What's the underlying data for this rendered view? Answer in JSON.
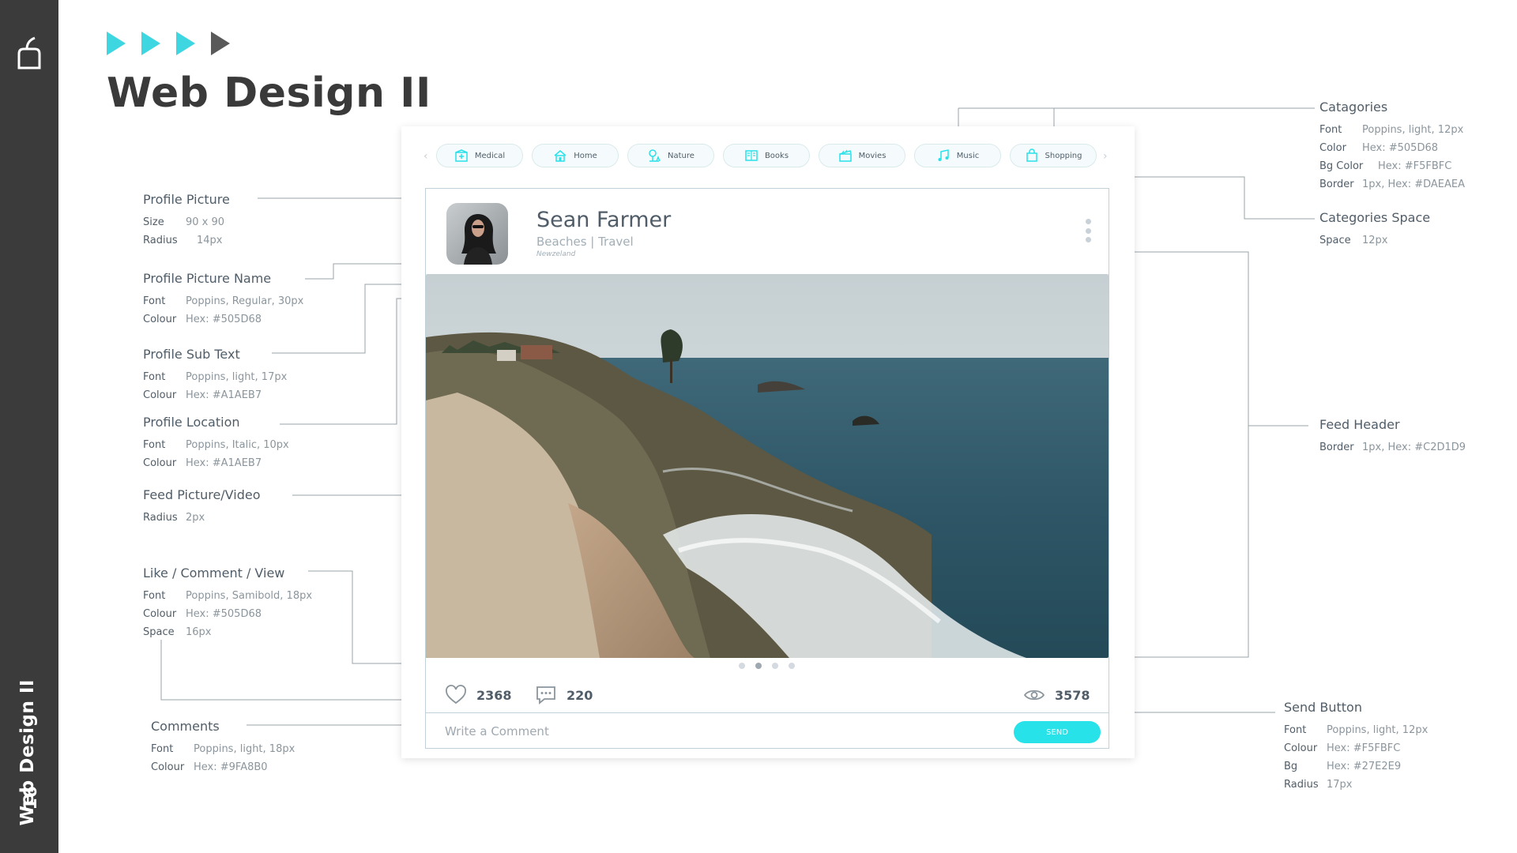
{
  "slide": {
    "title": "Web Design II",
    "rail_label": "Web Design II",
    "page_number": "16",
    "arrow_colors": [
      "#3ED6E0",
      "#3ED6E0",
      "#3ED6E0",
      "#5a5a5a"
    ]
  },
  "annotations": {
    "profile_picture": {
      "title": "Profile Picture",
      "rows": [
        [
          "Size",
          "90 x 90"
        ],
        [
          "Radius",
          "14px"
        ]
      ]
    },
    "profile_name": {
      "title": "Profile Picture Name",
      "rows": [
        [
          "Font",
          "Poppins, Regular, 30px"
        ],
        [
          "Colour",
          "Hex: #505D68"
        ]
      ]
    },
    "profile_sub": {
      "title": "Profile Sub Text",
      "rows": [
        [
          "Font",
          "Poppins, light, 17px"
        ],
        [
          "Colour",
          "Hex: #A1AEB7"
        ]
      ]
    },
    "profile_location": {
      "title": "Profile Location",
      "rows": [
        [
          "Font",
          "Poppins, Italic, 10px"
        ],
        [
          "Colour",
          "Hex: #A1AEB7"
        ]
      ]
    },
    "feed_picture": {
      "title": "Feed Picture/Video",
      "rows": [
        [
          "Radius",
          "2px"
        ]
      ]
    },
    "like_comment_view": {
      "title": "Like / Comment / View",
      "rows": [
        [
          "Font",
          "Poppins, Samibold, 18px"
        ],
        [
          "Colour",
          "Hex: #505D68"
        ],
        [
          "Space",
          "16px"
        ]
      ]
    },
    "comments": {
      "title": "Comments",
      "rows": [
        [
          "Font",
          "Poppins, light, 18px"
        ],
        [
          "Colour",
          "Hex: #9FA8B0"
        ]
      ]
    },
    "categories": {
      "title": "Catagories",
      "rows": [
        [
          "Font",
          "Poppins, light, 12px"
        ],
        [
          "Color",
          "Hex: #505D68"
        ],
        [
          "Bg Color",
          "Hex: #F5FBFC"
        ],
        [
          "Border",
          "1px, Hex: #DAEAEA"
        ]
      ]
    },
    "categories_space": {
      "title": "Categories Space",
      "rows": [
        [
          "Space",
          "12px"
        ]
      ]
    },
    "feed_header": {
      "title": "Feed Header",
      "rows": [
        [
          "Border",
          "1px, Hex: #C2D1D9"
        ]
      ]
    },
    "send_button": {
      "title": "Send Button",
      "rows": [
        [
          "Font",
          "Poppins, light, 12px"
        ],
        [
          "Colour",
          "Hex: #F5FBFC"
        ],
        [
          "Bg",
          "Hex: #27E2E9"
        ],
        [
          "Radius",
          "17px"
        ]
      ]
    }
  },
  "categories": [
    {
      "label": "Medical",
      "icon": "hospital-icon"
    },
    {
      "label": "Home",
      "icon": "home-icon"
    },
    {
      "label": "Nature",
      "icon": "nature-icon"
    },
    {
      "label": "Books",
      "icon": "book-icon"
    },
    {
      "label": "Movies",
      "icon": "clapper-icon"
    },
    {
      "label": "Music",
      "icon": "music-icon"
    },
    {
      "label": "Shopping",
      "icon": "shopping-bag-icon"
    }
  ],
  "feed": {
    "name": "Sean Farmer",
    "sub": "Beaches | Travel",
    "location": "Newzeland",
    "likes": "2368",
    "comments": "220",
    "views": "3578",
    "carousel": {
      "count": 4,
      "active": 1
    },
    "comment_placeholder": "Write a Comment",
    "send_label": "SEND"
  },
  "colors": {
    "accent": "#27E2E9",
    "text": "#505D68",
    "subtext": "#A1AEB7",
    "pill_bg": "#F5FBFC",
    "pill_border": "#DAEAEA",
    "feed_border": "#C2D1D9"
  }
}
